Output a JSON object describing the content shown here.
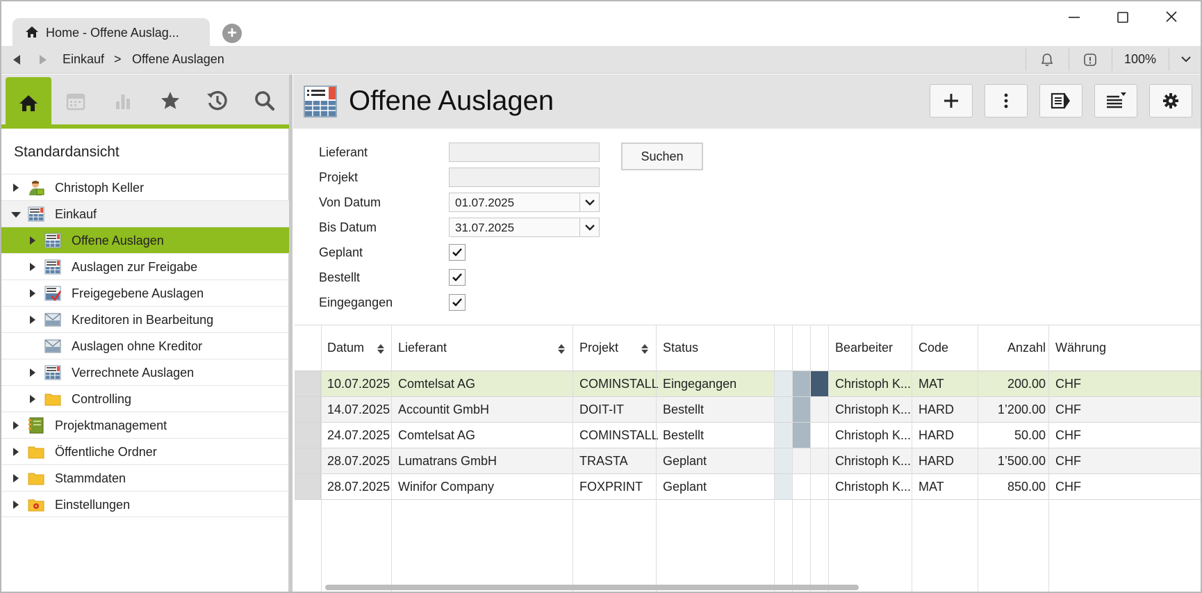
{
  "window": {
    "tab_label": "Home - Offene Auslag...",
    "controls": [
      "minimize",
      "maximize",
      "close"
    ]
  },
  "navbar": {
    "breadcrumb": [
      "Einkauf",
      ">",
      "Offene Auslagen"
    ],
    "zoom": "100%"
  },
  "sidebar": {
    "tools": [
      "home-icon",
      "calendar-icon",
      "chart-icon",
      "star-icon",
      "history-icon",
      "search-icon"
    ],
    "view_title": "Standardansicht",
    "tree": [
      {
        "label": "Christoph Keller",
        "level": 0,
        "expandable": true,
        "expanded": false,
        "icon": "user-icon"
      },
      {
        "label": "Einkauf",
        "level": 0,
        "expandable": true,
        "expanded": true,
        "icon": "list-icon"
      },
      {
        "label": "Offene Auslagen",
        "level": 1,
        "expandable": true,
        "expanded": false,
        "icon": "list-icon",
        "selected": true
      },
      {
        "label": "Auslagen zur Freigabe",
        "level": 1,
        "expandable": true,
        "expanded": false,
        "icon": "list-icon"
      },
      {
        "label": "Freigegebene Auslagen",
        "level": 1,
        "expandable": true,
        "expanded": false,
        "icon": "approved-list-icon"
      },
      {
        "label": "Kreditoren in Bearbeitung",
        "level": 1,
        "expandable": true,
        "expanded": false,
        "icon": "mail-list-icon"
      },
      {
        "label": "Auslagen ohne Kreditor",
        "level": 1,
        "expandable": false,
        "expanded": false,
        "icon": "mail-list-icon"
      },
      {
        "label": "Verrechnete Auslagen",
        "level": 1,
        "expandable": true,
        "expanded": false,
        "icon": "list-icon"
      },
      {
        "label": "Controlling",
        "level": 1,
        "expandable": true,
        "expanded": false,
        "icon": "folder-icon"
      },
      {
        "label": "Projektmanagement",
        "level": 0,
        "expandable": true,
        "expanded": false,
        "icon": "project-icon"
      },
      {
        "label": "Öffentliche Ordner",
        "level": 0,
        "expandable": true,
        "expanded": false,
        "icon": "folder-icon"
      },
      {
        "label": "Stammdaten",
        "level": 0,
        "expandable": true,
        "expanded": false,
        "icon": "folder-icon"
      },
      {
        "label": "Einstellungen",
        "level": 0,
        "expandable": true,
        "expanded": false,
        "icon": "settings-folder-icon"
      }
    ]
  },
  "main": {
    "title": "Offene Auslagen",
    "toolbar": [
      "add-icon",
      "more-icon",
      "panel-icon",
      "list-sort-icon",
      "gear-icon"
    ],
    "filters": {
      "lieferant_label": "Lieferant",
      "lieferant_value": "",
      "projekt_label": "Projekt",
      "projekt_value": "",
      "von_label": "Von Datum",
      "von_value": "01.07.2025",
      "bis_label": "Bis Datum",
      "bis_value": "31.07.2025",
      "geplant_label": "Geplant",
      "bestellt_label": "Bestellt",
      "eingegangen_label": "Eingegangen",
      "search_label": "Suchen"
    },
    "grid": {
      "headers": {
        "datum": "Datum",
        "lieferant": "Lieferant",
        "projekt": "Projekt",
        "status": "Status",
        "bearbeiter": "Bearbeiter",
        "code": "Code",
        "anzahl": "Anzahl",
        "waehrung": "Währung"
      },
      "rows": [
        {
          "datum": "10.07.2025",
          "lieferant": "Comtelsat AG",
          "projekt": "COMINSTALL",
          "status": "Eingegangen",
          "bearbeiter": "Christoph K...",
          "code": "MAT",
          "anzahl": "200.00",
          "waehrung": "CHF",
          "stage": 3
        },
        {
          "datum": "14.07.2025",
          "lieferant": "Accountit GmbH",
          "projekt": "DOIT-IT",
          "status": "Bestellt",
          "bearbeiter": "Christoph K...",
          "code": "HARD",
          "anzahl": "1’200.00",
          "waehrung": "CHF",
          "stage": 2
        },
        {
          "datum": "24.07.2025",
          "lieferant": "Comtelsat AG",
          "projekt": "COMINSTALL",
          "status": "Bestellt",
          "bearbeiter": "Christoph K...",
          "code": "HARD",
          "anzahl": "50.00",
          "waehrung": "CHF",
          "stage": 2
        },
        {
          "datum": "28.07.2025",
          "lieferant": "Lumatrans GmbH",
          "projekt": "TRASTA",
          "status": "Geplant",
          "bearbeiter": "Christoph K...",
          "code": "HARD",
          "anzahl": "1’500.00",
          "waehrung": "CHF",
          "stage": 1
        },
        {
          "datum": "28.07.2025",
          "lieferant": "Winifor Company",
          "projekt": "FOXPRINT",
          "status": "Geplant",
          "bearbeiter": "Christoph K...",
          "code": "MAT",
          "anzahl": "850.00",
          "waehrung": "CHF",
          "stage": 1
        }
      ]
    }
  },
  "colors": {
    "accent": "#8fbc1e",
    "selected_row": "#e6efd2",
    "stage1": "#e4ebef",
    "stage2": "#a9b8c2",
    "stage3": "#425a72"
  }
}
